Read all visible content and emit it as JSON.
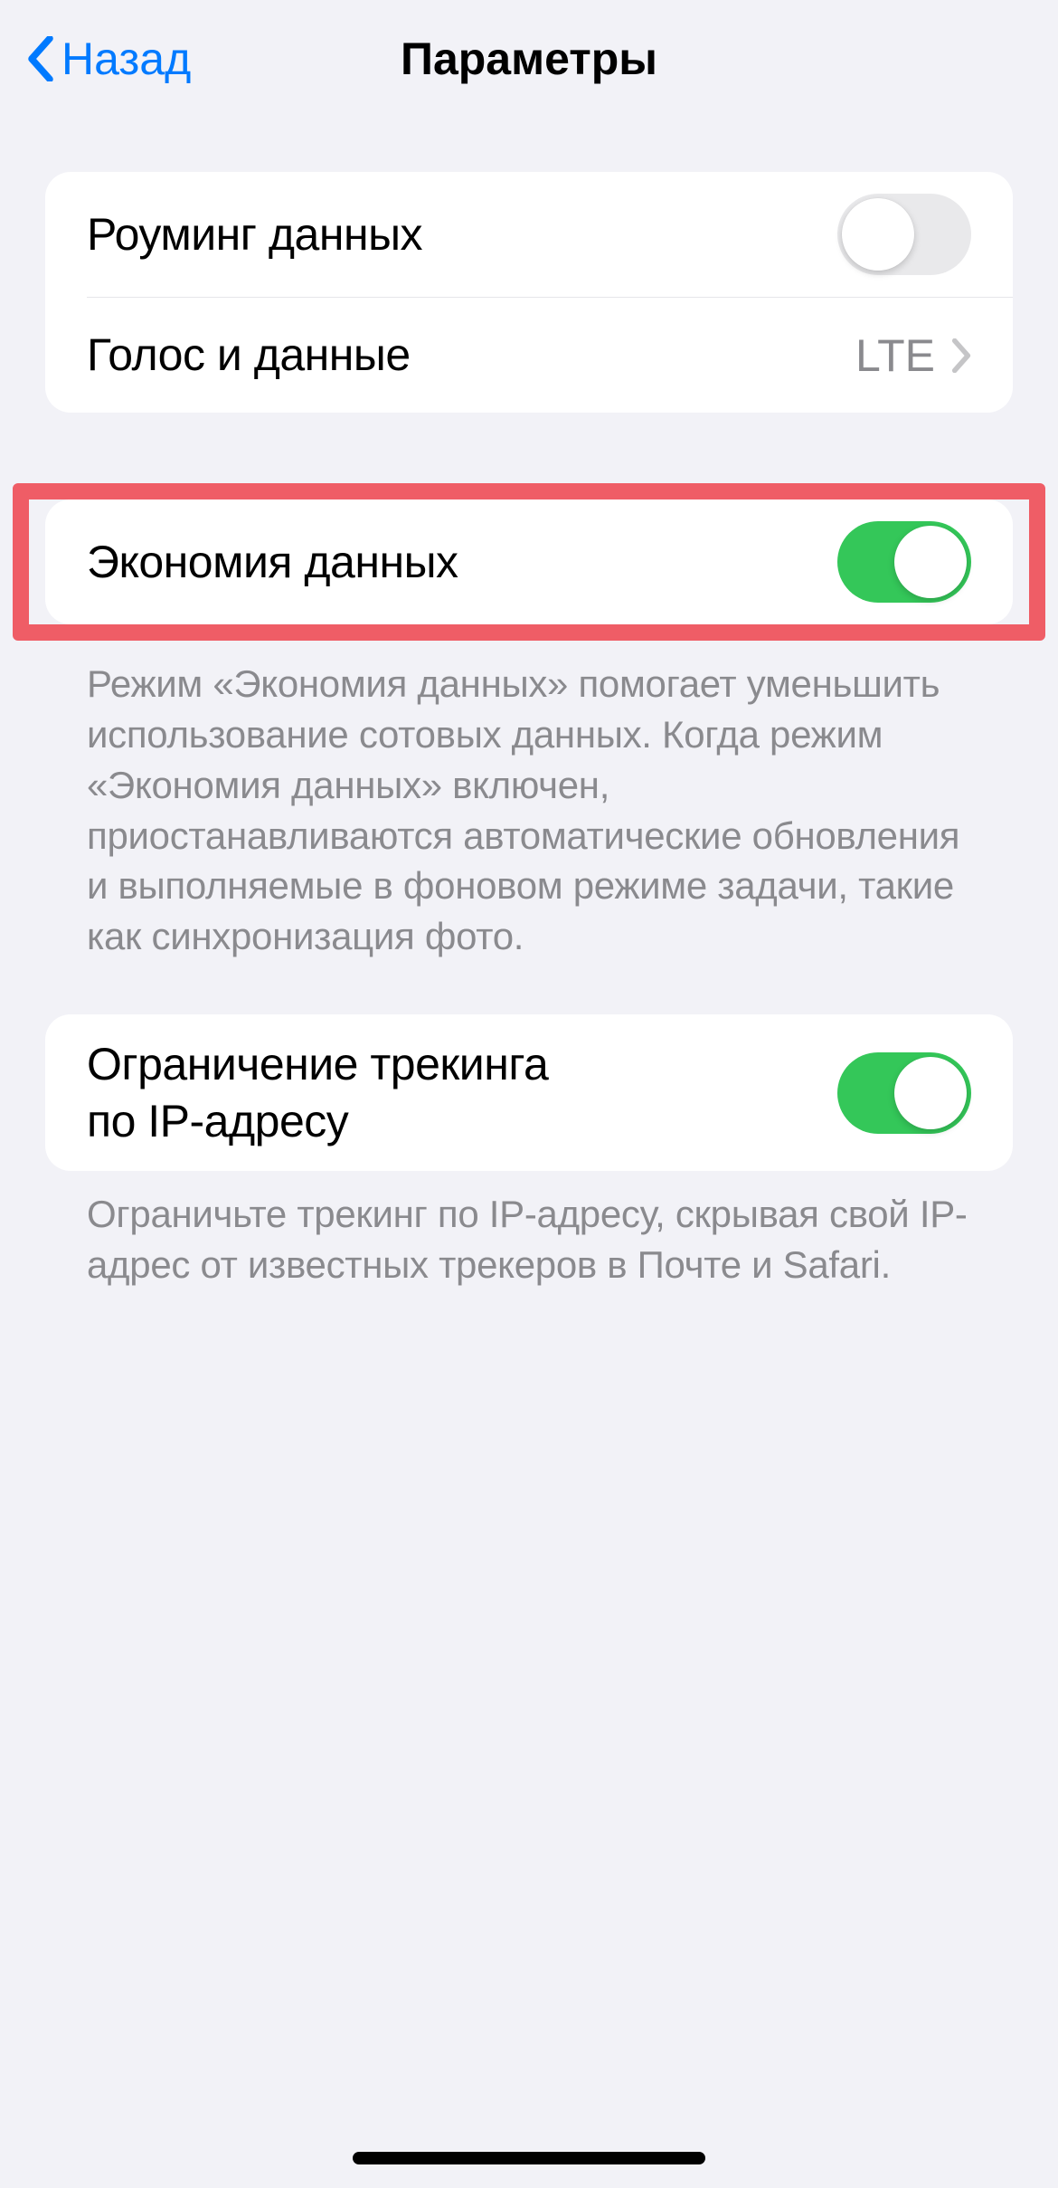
{
  "nav": {
    "back_label": "Назад",
    "title": "Параметры"
  },
  "group1": {
    "roaming_label": "Роуминг данных",
    "roaming_on": false,
    "voice_data_label": "Голос и данные",
    "voice_data_value": "LTE"
  },
  "group2": {
    "low_data_label": "Экономия данных",
    "low_data_on": true,
    "footer": "Режим «Экономия данных» помогает уменьшить использование сотовых данных. Когда режим «Экономия данных» включен, приостанавливаются автоматические обновления и выполняемые в фоновом режиме задачи, такие как синхронизация фото."
  },
  "group3": {
    "ip_tracking_label": "Ограничение трекинга по IP-адресу",
    "ip_tracking_on": true,
    "footer": "Ограничьте трекинг по IP-адресу, скрывая свой IP-адрес от известных трекеров в Почте и Safari."
  }
}
